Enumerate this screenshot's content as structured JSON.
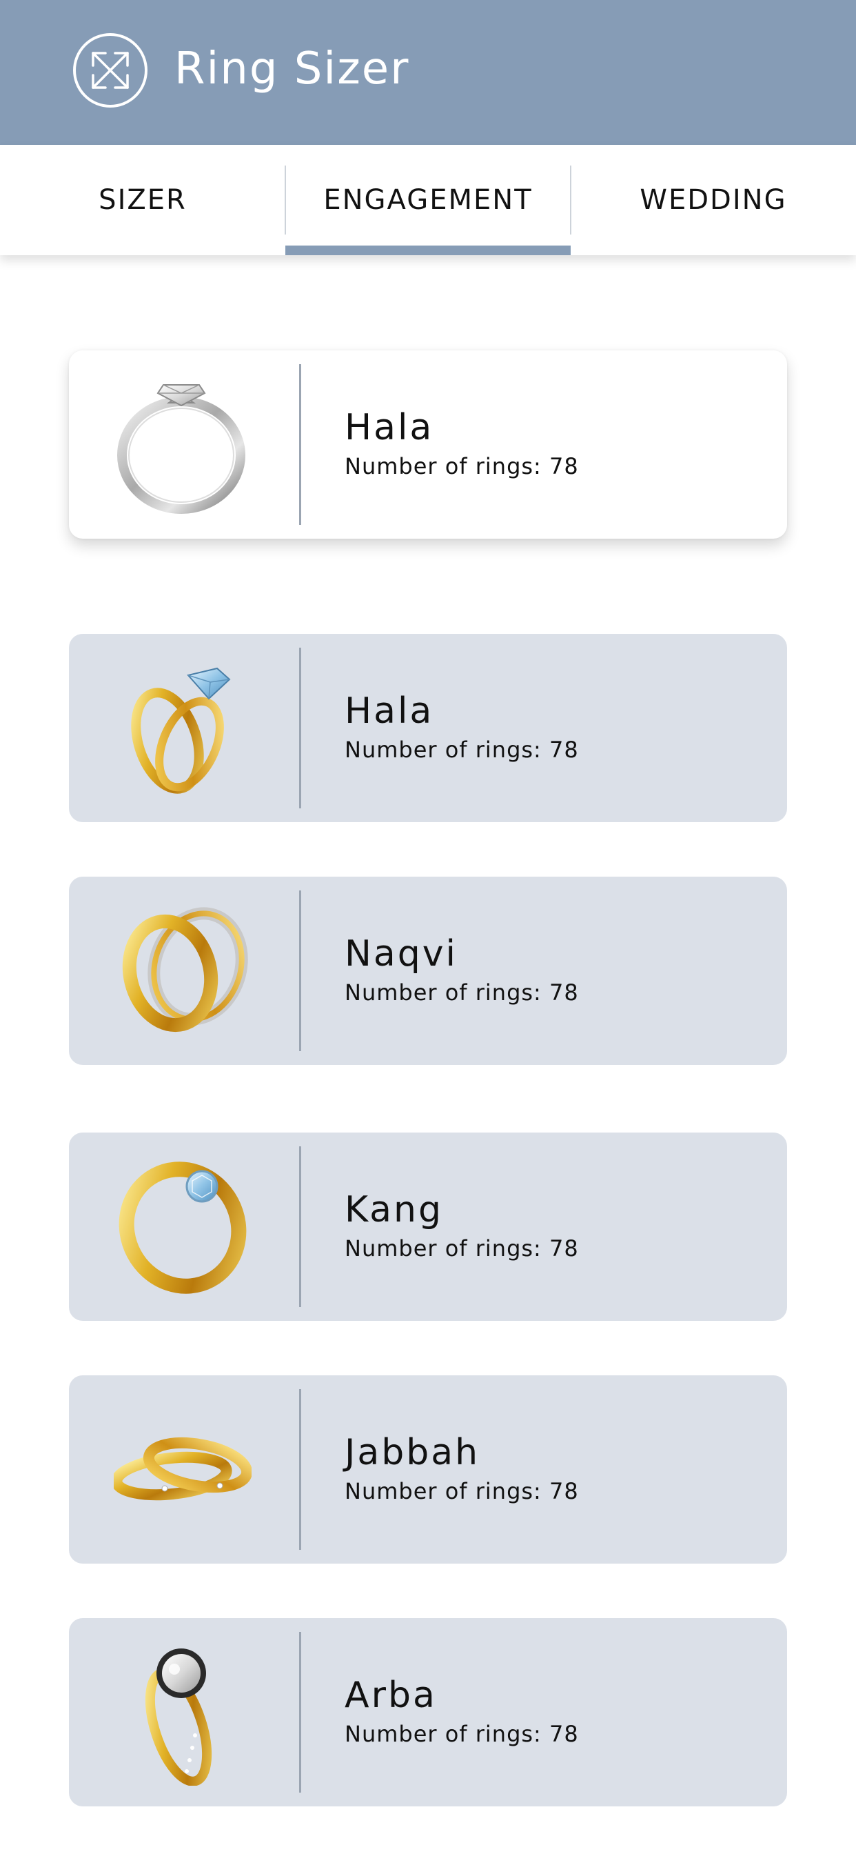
{
  "header": {
    "title": "Ring Sizer",
    "logo_icon": "expand-arrows-icon"
  },
  "tabs": [
    {
      "label": "SIZER",
      "active": false
    },
    {
      "label": "ENGAGEMENT",
      "active": true
    },
    {
      "label": "WEDDING",
      "active": false
    }
  ],
  "colors": {
    "header_bg": "#869cb6",
    "card_bg": "#dbe0e8",
    "selected_card_bg": "#ffffff",
    "active_tab_indicator": "#869cb6"
  },
  "cards": [
    {
      "name": "Hala",
      "count_text": "Number of rings: 78",
      "image": "silver-solitaire-ring-icon",
      "selected": true
    },
    {
      "name": "Hala",
      "count_text": "Number of rings: 78",
      "image": "gold-diamond-ring-pair-icon",
      "selected": false
    },
    {
      "name": "Naqvi",
      "count_text": "Number of rings: 78",
      "image": "gold-wedding-bands-icon",
      "selected": false
    },
    {
      "name": "Kang",
      "count_text": "Number of rings: 78",
      "image": "gold-solitaire-ring-icon",
      "selected": false
    },
    {
      "name": "Jabbah",
      "count_text": "Number of rings: 78",
      "image": "gold-stacked-bands-icon",
      "selected": false
    },
    {
      "name": "Arba",
      "count_text": "Number of rings: 78",
      "image": "gold-cluster-ring-icon",
      "selected": false
    }
  ]
}
